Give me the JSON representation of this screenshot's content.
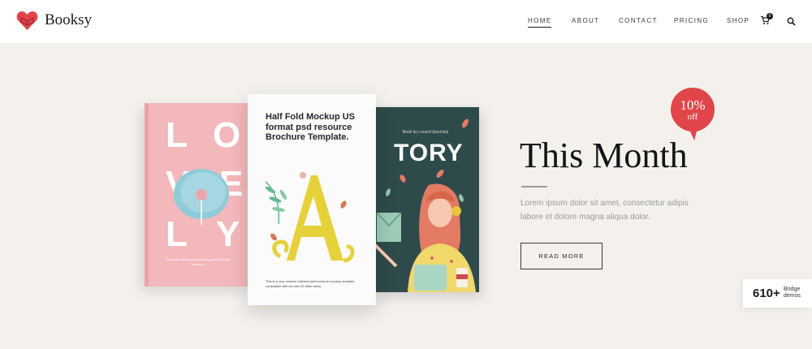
{
  "brand": {
    "name": "Booksy",
    "logo_icon": "heart-book-icon",
    "accent_color": "#e0454a"
  },
  "nav": {
    "items": [
      {
        "label": "HOME",
        "active": true
      },
      {
        "label": "ABOUT",
        "active": false
      },
      {
        "label": "CONTACT",
        "active": false
      },
      {
        "label": "PRICING",
        "active": false
      },
      {
        "label": "SHOP",
        "active": false
      }
    ],
    "cart_icon": "cart-icon",
    "cart_count": "0",
    "search_icon": "search-icon"
  },
  "hero": {
    "books": {
      "pink": {
        "letters": [
          "L",
          "O",
          "V",
          "E",
          "L",
          "Y"
        ],
        "fine_print": "Prototype floating lovely background A5 size mockup"
      },
      "white": {
        "title": "Half Fold Mockup US format psd resource Brochure Template.",
        "fine_print": "This is a very modern half-fold psd brochure mockup template compatible with A4 and US letter sizes."
      },
      "dark": {
        "small_text": "Book by Lorand Ipsumaly",
        "title": "TORY"
      }
    },
    "headline": "This Month",
    "body": "Lorem ipsum dolor sit amet, consectetur adipis labore et dolore magna aliqua dolor.",
    "cta_label": "READ MORE",
    "badge": {
      "percent": "10%",
      "off": "off",
      "color": "#e0454a"
    }
  },
  "demos_widget": {
    "count": "610+",
    "label": "Bridge demos"
  }
}
